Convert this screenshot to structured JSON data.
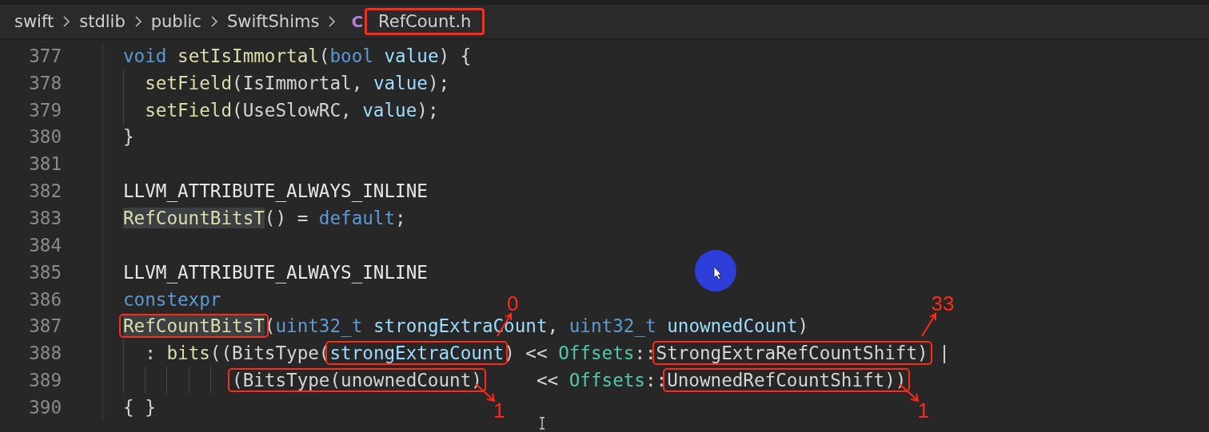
{
  "breadcrumb": {
    "items": [
      "swift",
      "stdlib",
      "public",
      "SwiftShims"
    ],
    "file_icon": "C",
    "file": "RefCount.h",
    "file_boxed": true
  },
  "lines": [
    {
      "number": "377",
      "tokens": [
        {
          "text": "void",
          "kind": "keyword"
        },
        {
          "text": " setIsImmortal",
          "kind": "function"
        },
        {
          "text": "(",
          "kind": "plain"
        },
        {
          "text": "bool",
          "kind": "keyword"
        },
        {
          "text": " value",
          "kind": "param"
        },
        {
          "text": ") {",
          "kind": "plain"
        }
      ]
    },
    {
      "number": "378",
      "tokens": [
        {
          "text": "  setField",
          "kind": "function"
        },
        {
          "text": "(IsImmortal, ",
          "kind": "plain"
        },
        {
          "text": "value",
          "kind": "param"
        },
        {
          "text": ");",
          "kind": "plain"
        }
      ]
    },
    {
      "number": "379",
      "tokens": [
        {
          "text": "  setField",
          "kind": "function"
        },
        {
          "text": "(UseSlowRC, ",
          "kind": "plain"
        },
        {
          "text": "value",
          "kind": "param"
        },
        {
          "text": ");",
          "kind": "plain"
        }
      ]
    },
    {
      "number": "380",
      "tokens": [
        {
          "text": "}",
          "kind": "plain"
        }
      ]
    },
    {
      "number": "381"
    },
    {
      "number": "382",
      "tokens": [
        {
          "text": "LLVM_ATTRIBUTE_ALWAYS_INLINE",
          "kind": "macro"
        }
      ]
    },
    {
      "number": "383",
      "tokens": [
        {
          "text": "RefCountBitsT",
          "kind": "function",
          "highlighted": true
        },
        {
          "text": "() = ",
          "kind": "plain"
        },
        {
          "text": "default",
          "kind": "keyword"
        },
        {
          "text": ";",
          "kind": "plain"
        }
      ]
    },
    {
      "number": "384"
    },
    {
      "number": "385",
      "tokens": [
        {
          "text": "LLVM_ATTRIBUTE_ALWAYS_INLINE",
          "kind": "macro"
        }
      ]
    },
    {
      "number": "386",
      "tokens": [
        {
          "text": "constexpr",
          "kind": "keyword"
        }
      ]
    },
    {
      "number": "387",
      "tokens": [
        {
          "text": "RefCountBitsT",
          "kind": "function",
          "highlighted": true,
          "boxed": true
        },
        {
          "text": "(",
          "kind": "plain"
        },
        {
          "text": "uint32_t",
          "kind": "keyword"
        },
        {
          "text": " strongExtraCount",
          "kind": "param"
        },
        {
          "text": ", ",
          "kind": "plain"
        },
        {
          "text": "uint32_t",
          "kind": "keyword"
        },
        {
          "text": " unownedCount",
          "kind": "param"
        },
        {
          "text": ")",
          "kind": "plain"
        }
      ]
    },
    {
      "number": "388",
      "tokens": [
        {
          "text": "  : ",
          "kind": "plain"
        },
        {
          "text": "bits",
          "kind": "function"
        },
        {
          "text": "((BitsType(",
          "kind": "plain"
        },
        {
          "text": "strongExtraCount",
          "kind": "param",
          "boxed": true,
          "note": "0",
          "note_above": true
        },
        {
          "text": ") << ",
          "kind": "plain"
        },
        {
          "text": "Offsets",
          "kind": "type"
        },
        {
          "text": "::",
          "kind": "plain"
        },
        {
          "text": "StrongExtraRefCountShift)",
          "kind": "plain",
          "boxed": true,
          "note": "33",
          "note_above": true
        },
        {
          "text": " |",
          "kind": "plain"
        }
      ]
    },
    {
      "number": "389",
      "tokens": [
        {
          "text": "          (BitsType(unownedCount)",
          "kind": "plain",
          "boxed": true,
          "note": "1",
          "note_above": false
        },
        {
          "text": "     << ",
          "kind": "plain"
        },
        {
          "text": "Offsets",
          "kind": "type"
        },
        {
          "text": "::",
          "kind": "plain"
        },
        {
          "text": "UnownedRefCountShift))",
          "kind": "plain",
          "boxed": true,
          "note": "1",
          "note_above": false
        }
      ]
    },
    {
      "number": "390",
      "tokens": [
        {
          "text": "{ }",
          "kind": "plain"
        }
      ]
    }
  ]
}
